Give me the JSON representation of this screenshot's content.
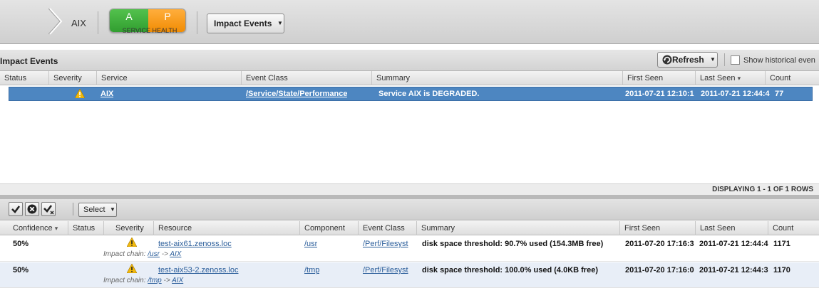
{
  "breadcrumb": {
    "current": "AIX"
  },
  "service_health": {
    "availability_letter": "A",
    "performance_letter": "P",
    "label": "SERVICE HEALTH",
    "availability_color": "#3caa38",
    "performance_color": "#f7961e"
  },
  "header": {
    "impact_events_button": "Impact Events"
  },
  "impact_panel": {
    "title": "Impact Events",
    "refresh_label": "Refresh",
    "historical_label": "Show historical even",
    "columns": [
      "Status",
      "Severity",
      "Service",
      "Event Class",
      "Summary",
      "First Seen",
      "Last Seen",
      "Count"
    ],
    "rows": [
      {
        "status": "",
        "severity": "warning-icon",
        "service": "AIX",
        "event_class": "/Service/State/Performance",
        "summary": "Service AIX is DEGRADED.",
        "first_seen": "2011-07-21 12:10:1",
        "last_seen": "2011-07-21 12:44:4",
        "count": "77"
      }
    ],
    "footer": "DISPLAYING 1 - 1 OF 1 ROWS",
    "sort_indicator": "▾"
  },
  "events_panel": {
    "select_label": "Select",
    "columns": [
      "Confidence",
      "Status",
      "Severity",
      "Resource",
      "Component",
      "Event Class",
      "Summary",
      "First Seen",
      "Last Seen",
      "Count"
    ],
    "rows": [
      {
        "confidence": "50%",
        "status": "",
        "resource": "test-aix61.zenoss.loc",
        "component": "/usr",
        "event_class": "/Perf/Filesyst",
        "summary": "disk space threshold: 90.7% used (154.3MB free)",
        "first_seen": "2011-07-20 17:16:3",
        "last_seen": "2011-07-21 12:44:4",
        "count": "1171",
        "chain_prefix": "Impact chain:",
        "chain_from": "/usr",
        "chain_arrow": "->",
        "chain_to": "AIX"
      },
      {
        "confidence": "50%",
        "status": "",
        "resource": "test-aix53-2.zenoss.loc",
        "component": "/tmp",
        "event_class": "/Perf/Filesyst",
        "summary": "disk space threshold: 100.0% used (4.0KB free)",
        "first_seen": "2011-07-20 17:16:0",
        "last_seen": "2011-07-21 12:44:3",
        "count": "1170",
        "chain_prefix": "Impact chain:",
        "chain_from": "/tmp",
        "chain_arrow": "->",
        "chain_to": "AIX"
      }
    ]
  },
  "colors": {
    "selected_row": "#4d86c1",
    "link": "#2a5d9a",
    "warning": "#f2b90c"
  }
}
